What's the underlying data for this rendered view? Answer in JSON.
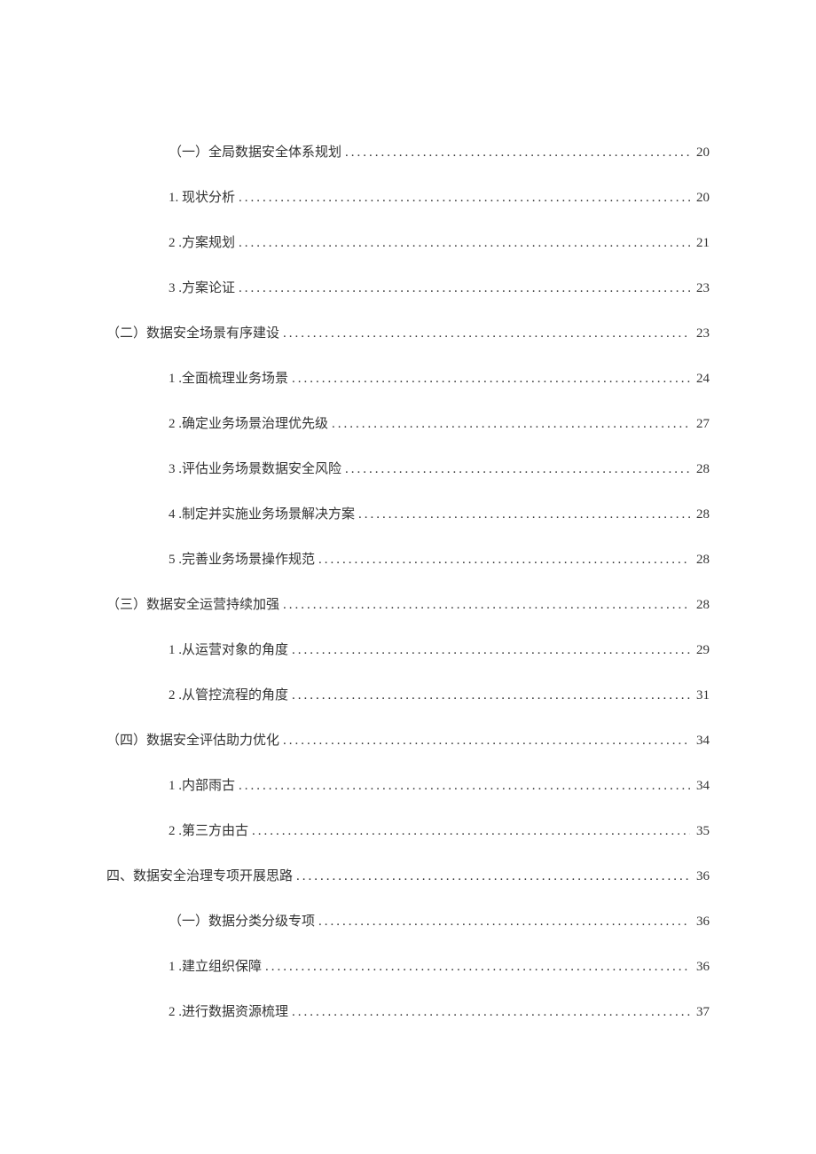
{
  "toc": {
    "entries": [
      {
        "indent": "indent-2",
        "text": "（一）全局数据安全体系规划",
        "page": "20"
      },
      {
        "indent": "indent-2",
        "text": "1. 现状分析",
        "page": "20"
      },
      {
        "indent": "indent-2",
        "text": "2   .方案规划",
        "page": "21"
      },
      {
        "indent": "indent-2",
        "text": "3   .方案论证",
        "page": "23"
      },
      {
        "indent": "indent-1",
        "text": "（二）数据安全场景有序建设",
        "page": "23"
      },
      {
        "indent": "indent-2",
        "text": "1   .全面梳理业务场景",
        "page": "24"
      },
      {
        "indent": "indent-2",
        "text": "2   .确定业务场景治理优先级",
        "page": "27"
      },
      {
        "indent": "indent-2",
        "text": "3   .评估业务场景数据安全风险",
        "page": "28"
      },
      {
        "indent": "indent-2",
        "text": "4   .制定并实施业务场景解决方案",
        "page": "28"
      },
      {
        "indent": "indent-2",
        "text": "5   .完善业务场景操作规范",
        "page": "28"
      },
      {
        "indent": "indent-1",
        "text": "（三）数据安全运营持续加强",
        "page": "28"
      },
      {
        "indent": "indent-2",
        "text": "1   .从运营对象的角度",
        "page": "29"
      },
      {
        "indent": "indent-2",
        "text": "2   .从管控流程的角度",
        "page": "31"
      },
      {
        "indent": "indent-1",
        "text": "（四）数据安全评估助力优化",
        "page": "34"
      },
      {
        "indent": "indent-2",
        "text": "1   .内部雨古",
        "page": "34"
      },
      {
        "indent": "indent-2",
        "text": "2   .第三方由古",
        "page": "35"
      },
      {
        "indent": "indent-1",
        "text": "四、数据安全治理专项开展思路",
        "page": "36"
      },
      {
        "indent": "indent-2",
        "text": "（一）数据分类分级专项",
        "page": "36"
      },
      {
        "indent": "indent-2",
        "text": "1   .建立组织保障",
        "page": "36"
      },
      {
        "indent": "indent-2",
        "text": "2   .进行数据资源梳理",
        "page": "37"
      }
    ]
  }
}
